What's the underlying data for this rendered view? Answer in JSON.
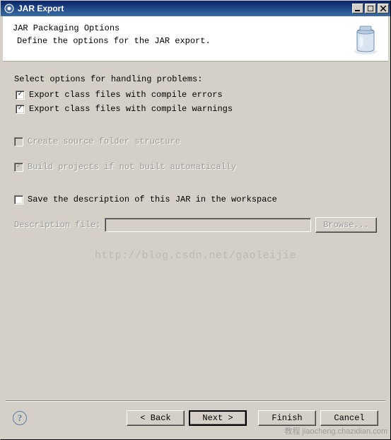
{
  "window": {
    "title": "JAR Export"
  },
  "header": {
    "title": "JAR Packaging Options",
    "description": "Define the options for the JAR export."
  },
  "content": {
    "section_label": "Select options for handling problems:",
    "export_errors": {
      "label": "Export class files with compile errors",
      "checked": true,
      "enabled": true
    },
    "export_warnings": {
      "label": "Export class files with compile warnings",
      "checked": true,
      "enabled": true
    },
    "create_source": {
      "label": "Create source folder structure",
      "checked": false,
      "enabled": false
    },
    "build_projects": {
      "label": "Build projects if not built automatically",
      "checked": true,
      "enabled": false
    },
    "save_description": {
      "label": "Save the description of this JAR in the workspace",
      "checked": false,
      "enabled": true
    },
    "description_file_label": "Description file:",
    "description_file_value": "",
    "browse_label": "Browse..."
  },
  "watermark": "http://blog.csdn.net/gaoleijie",
  "footer": {
    "back": "< Back",
    "next": "Next >",
    "finish": "Finish",
    "cancel": "Cancel"
  },
  "corner": "教程 jiaocheng.chazidian.com"
}
